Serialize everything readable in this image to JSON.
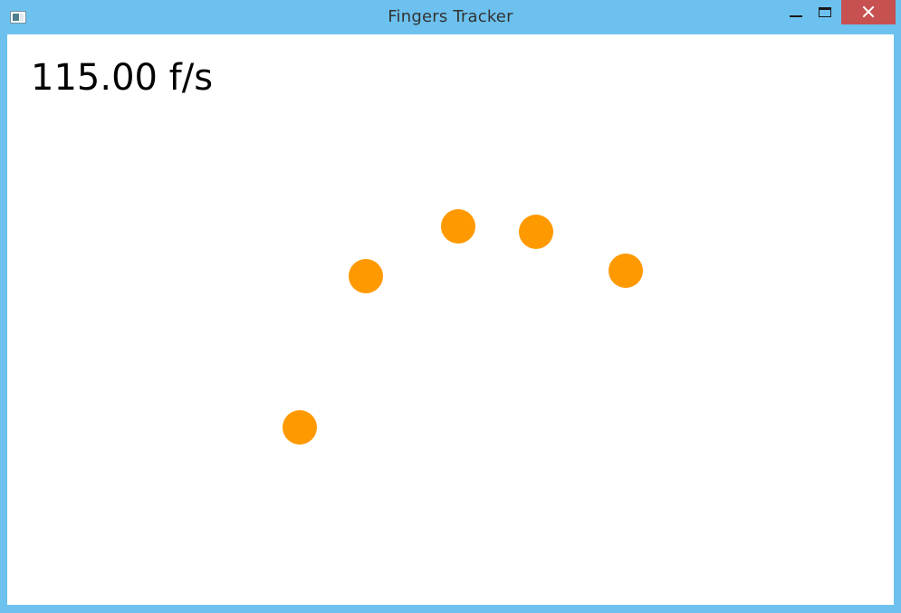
{
  "window": {
    "title": "Fingers Tracker",
    "frame_color": "#6cc1ee",
    "close_button_color": "#c75050"
  },
  "titlebar": {
    "app_icon": "app-window-icon",
    "controls": [
      {
        "name": "minimize",
        "icon": "minimize-icon"
      },
      {
        "name": "maximize",
        "icon": "maximize-icon"
      },
      {
        "name": "close",
        "icon": "close-icon"
      }
    ]
  },
  "main": {
    "fps_readout": "115.00 f/s",
    "finger_color": "#ff9900",
    "finger_count": 5
  }
}
